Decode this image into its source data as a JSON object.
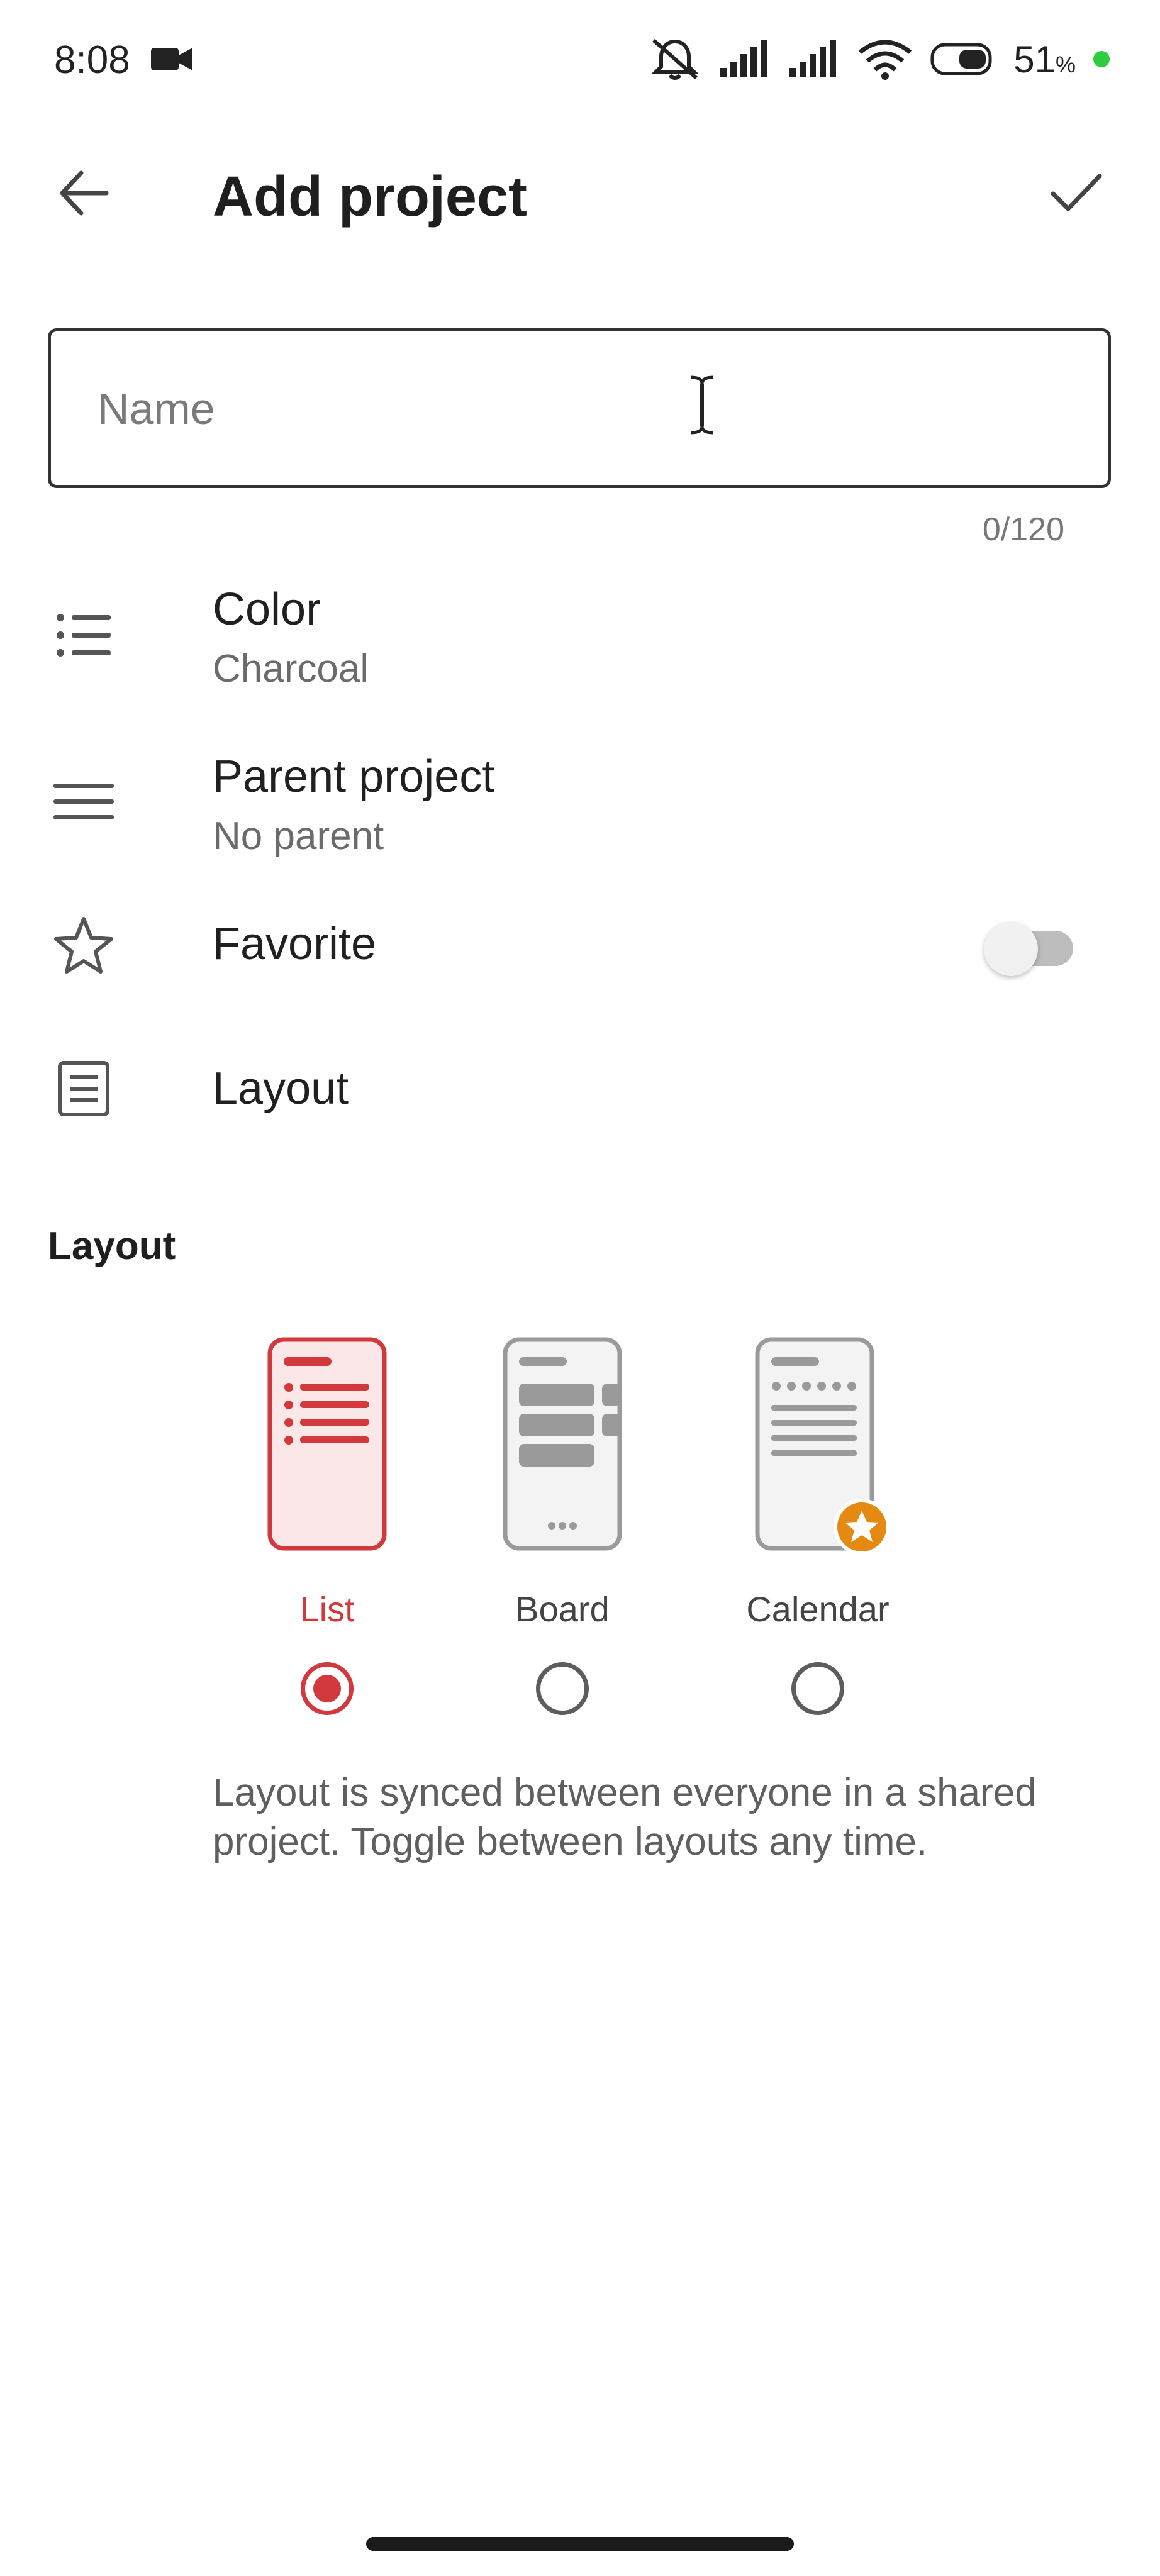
{
  "status_bar": {
    "time": "8:08",
    "battery_percent": "51",
    "battery_unit": "%",
    "icons": [
      "video-camera-icon",
      "bell-off-icon",
      "signal-icon",
      "signal-icon",
      "wifi-icon",
      "battery-icon"
    ]
  },
  "header": {
    "title": "Add project",
    "back_icon": "arrow-left-icon",
    "confirm_icon": "check-icon"
  },
  "name_field": {
    "placeholder": "Name",
    "value": "",
    "char_count": "0/120"
  },
  "rows": {
    "color": {
      "title": "Color",
      "value": "Charcoal",
      "icon": "list-icon"
    },
    "parent": {
      "title": "Parent project",
      "value": "No parent",
      "icon": "menu-lines-icon"
    },
    "favorite": {
      "title": "Favorite",
      "icon": "star-outline-icon",
      "enabled": false
    },
    "layout": {
      "title": "Layout",
      "icon": "document-icon"
    }
  },
  "layout_section": {
    "title": "Layout",
    "options": [
      {
        "label": "List",
        "selected": true
      },
      {
        "label": "Board",
        "selected": false
      },
      {
        "label": "Calendar",
        "selected": false
      }
    ],
    "description": "Layout is synced between everyone in a shared project. Toggle between layouts any time."
  },
  "colors": {
    "accent_red": "#d1393d",
    "calendar_badge": "#e48a12",
    "text_primary": "#202020",
    "text_secondary": "#6b6b6b"
  }
}
